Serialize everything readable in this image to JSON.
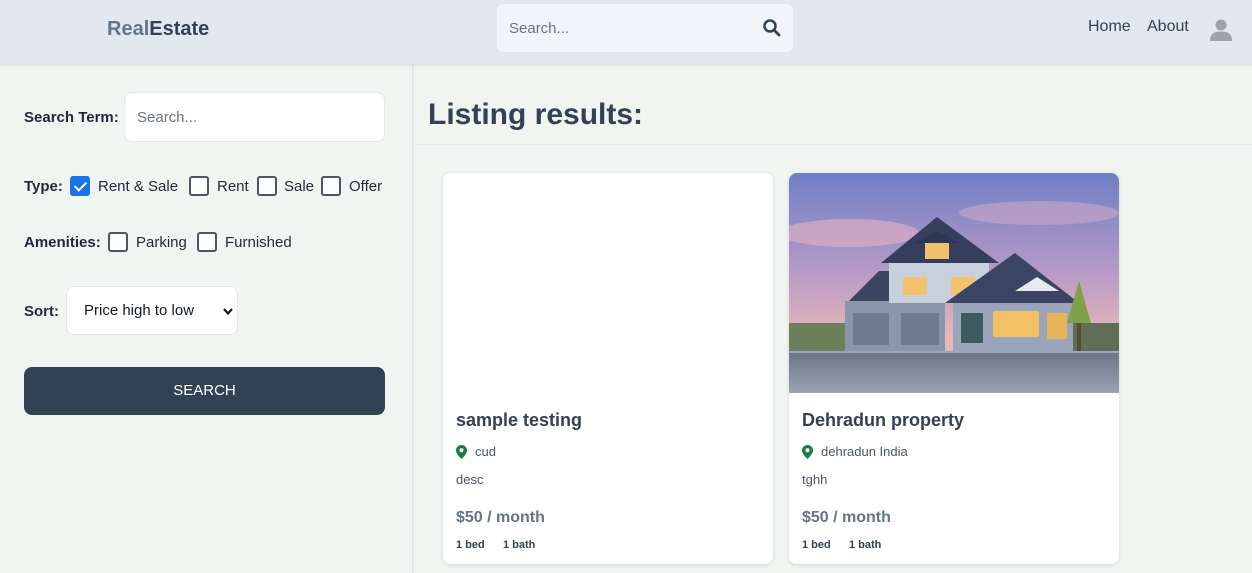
{
  "header": {
    "brand_part1": "Real",
    "brand_part2": "Estate",
    "search_placeholder": "Search...",
    "nav": {
      "home": "Home",
      "about": "About"
    }
  },
  "sidebar": {
    "search_term_label": "Search Term:",
    "search_term_placeholder": "Search...",
    "type_label": "Type:",
    "type_options": [
      {
        "label": "Rent & Sale",
        "checked": true
      },
      {
        "label": "Rent",
        "checked": false
      },
      {
        "label": "Sale",
        "checked": false
      },
      {
        "label": "Offer",
        "checked": false
      }
    ],
    "amenities_label": "Amenities:",
    "amenities_options": [
      {
        "label": "Parking",
        "checked": false
      },
      {
        "label": "Furnished",
        "checked": false
      }
    ],
    "sort_label": "Sort:",
    "sort_value": "Price high to low",
    "search_button": "SEARCH"
  },
  "main": {
    "heading": "Listing results:",
    "listings": [
      {
        "title": "sample testing",
        "location": "cud",
        "description": "desc",
        "price": "$50 / month",
        "beds": "1 bed",
        "baths": "1 bath",
        "has_image": false
      },
      {
        "title": "Dehradun property",
        "location": "dehradun India",
        "description": "tghh",
        "price": "$50 / month",
        "beds": "1 bed",
        "baths": "1 bath",
        "has_image": true
      }
    ]
  },
  "colors": {
    "header_bg": "#e2e8f0",
    "page_bg": "#f1f5f1",
    "button_bg": "#334155",
    "checkbox_checked": "#1a73e8",
    "pin": "#15803d"
  }
}
